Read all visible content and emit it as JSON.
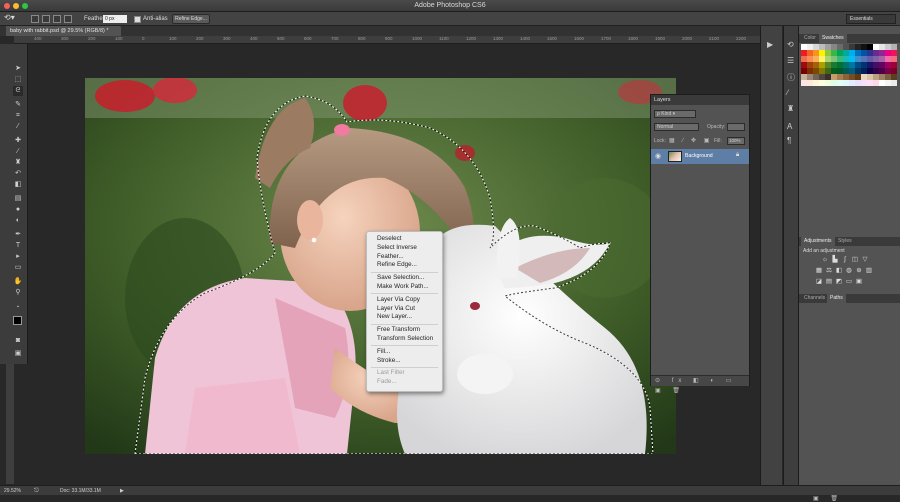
{
  "window": {
    "title": "Adobe Photoshop CS6"
  },
  "options_bar": {
    "feather_label": "Feather:",
    "feather_value": "0 px",
    "antialias_label": "Anti-alias",
    "refine_edge_label": "Refine Edge...",
    "workspace": "Essentials"
  },
  "document": {
    "tab_label": "baby with rabbit.psd @ 29.5% (RGB/8) *",
    "ruler_marks": [
      "400",
      "300",
      "200",
      "100",
      "0",
      "100",
      "200",
      "300",
      "400",
      "500",
      "600",
      "700",
      "800",
      "900",
      "1000",
      "1100",
      "1200",
      "1300",
      "1400",
      "1500",
      "1600",
      "1700",
      "1800",
      "1900",
      "2000",
      "2100",
      "2200",
      "2300",
      "2400",
      "2500",
      "2600",
      "2700",
      "2800"
    ]
  },
  "context_menu": {
    "groups": [
      [
        {
          "label": "Deselect",
          "enabled": true
        },
        {
          "label": "Select Inverse",
          "enabled": true
        },
        {
          "label": "Feather...",
          "enabled": true
        },
        {
          "label": "Refine Edge...",
          "enabled": true
        }
      ],
      [
        {
          "label": "Save Selection...",
          "enabled": true
        },
        {
          "label": "Make Work Path...",
          "enabled": true
        }
      ],
      [
        {
          "label": "Layer Via Copy",
          "enabled": true
        },
        {
          "label": "Layer Via Cut",
          "enabled": true
        },
        {
          "label": "New Layer...",
          "enabled": true
        }
      ],
      [
        {
          "label": "Free Transform",
          "enabled": true
        },
        {
          "label": "Transform Selection",
          "enabled": true
        }
      ],
      [
        {
          "label": "Fill...",
          "enabled": true
        },
        {
          "label": "Stroke...",
          "enabled": true
        }
      ],
      [
        {
          "label": "Last Filter",
          "enabled": false
        },
        {
          "label": "Fade...",
          "enabled": false
        }
      ]
    ]
  },
  "layers_panel": {
    "title": "Layers",
    "filter_kind": "Kind",
    "blend_mode": "Normal",
    "opacity_label": "Opacity:",
    "lock_label": "Lock:",
    "fill_label": "Fill:",
    "fill_value": "100%",
    "layers": [
      {
        "name": "Background",
        "visible": true,
        "locked": true
      }
    ]
  },
  "color_panel": {
    "tabs": [
      "Color",
      "Swatches"
    ],
    "active": "Swatches"
  },
  "adjustments_panel": {
    "tabs": [
      "Adjustments",
      "Styles"
    ],
    "active": "Adjustments",
    "hint": "Add an adjustment"
  },
  "bottom_panel": {
    "tabs": [
      "Channels",
      "Paths"
    ],
    "active": "Paths"
  },
  "status_bar": {
    "zoom": "29.52%",
    "doc_info": "Doc: 33.1M/33.1M"
  },
  "colors": {
    "selection": "#ffffff",
    "menu_bg": "#ededed",
    "ui_dark": "#3c3c3c",
    "panel": "#535353",
    "highlight": "#5f7ea6"
  }
}
